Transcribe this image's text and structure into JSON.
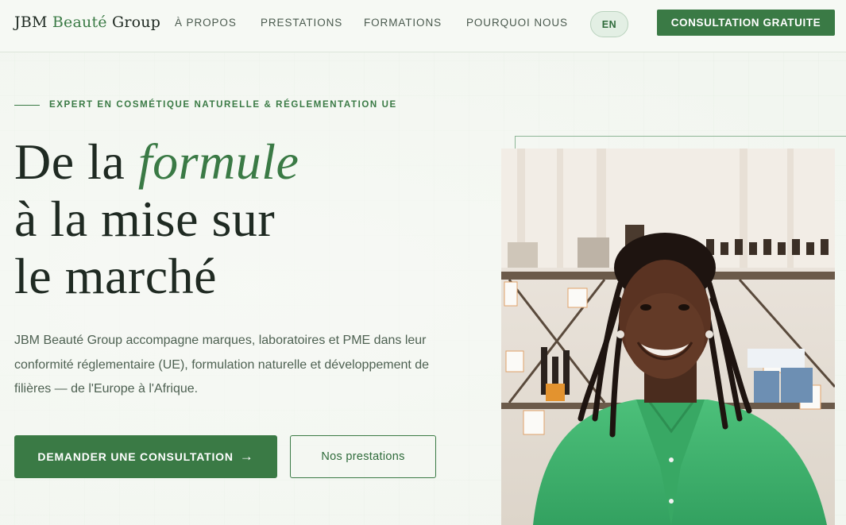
{
  "header": {
    "logo": {
      "part1": "JBM ",
      "accent": "Beauté",
      "part2": " Group"
    },
    "nav": [
      {
        "label": "À PROPOS"
      },
      {
        "label": "PRESTATIONS"
      },
      {
        "label": "FORMATIONS"
      },
      {
        "label": "POURQUOI NOUS"
      }
    ],
    "lang": "EN",
    "cta": "CONSULTATION GRATUITE"
  },
  "hero": {
    "eyebrow": "EXPERT EN COSMÉTIQUE NATURELLE & RÉGLEMENTATION UE",
    "headline": {
      "line1_prefix": "De la ",
      "line1_emphasis": "formule",
      "line2": "à la mise sur",
      "line3": "le marché"
    },
    "lede": "JBM Beauté Group accompagne marques, laboratoires et PME dans leur conformité réglementaire (UE), formulation naturelle et développement de filières — de l'Europe à l'Afrique.",
    "primary_button": "DEMANDER UNE CONSULTATION",
    "primary_button_arrow": "→",
    "secondary_button": "Nos prestations"
  },
  "colors": {
    "brand_green": "#3a7a45",
    "text_dark": "#1f2a22",
    "text_muted": "#4e6152",
    "background": "#f4f7f2",
    "shirt_green": "#3fae6a"
  },
  "image": {
    "alt": "Smiling woman in a green shirt standing in front of shelves of cosmetic products"
  }
}
